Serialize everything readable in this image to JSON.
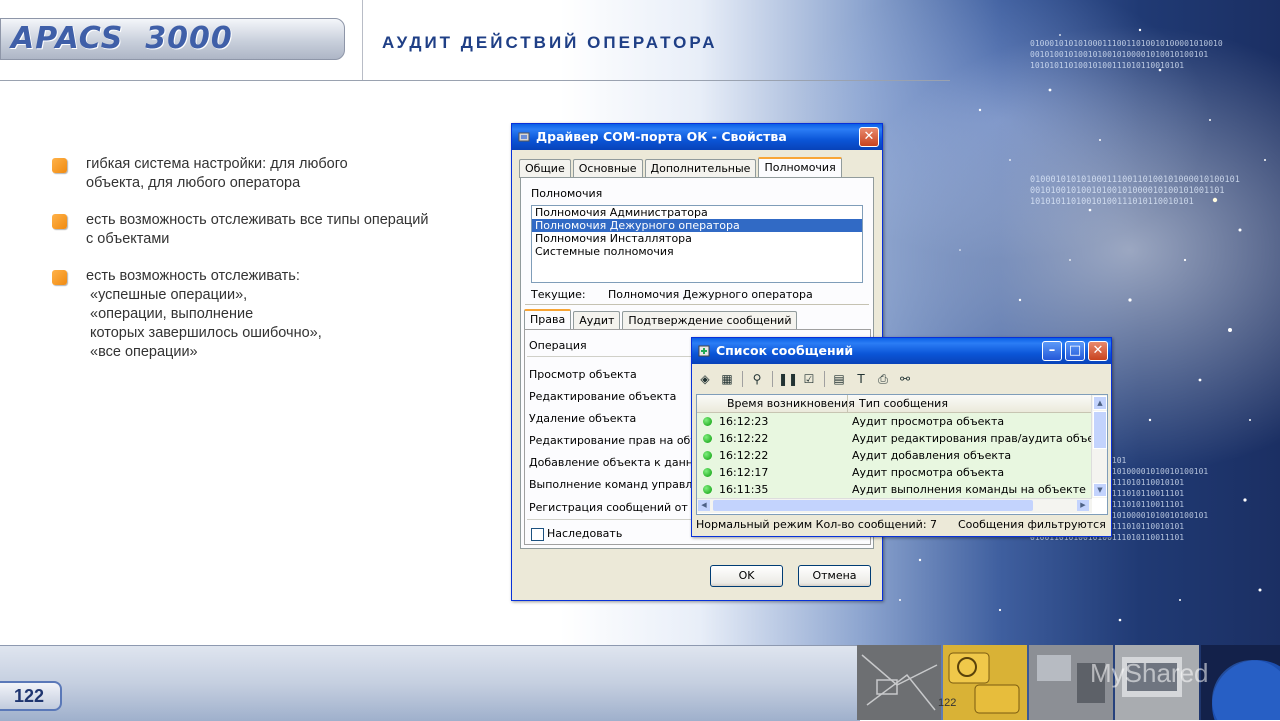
{
  "logo": {
    "brand": "APACS",
    "number": "3000"
  },
  "page_title": "АУДИТ ДЕЙСТВИЙ ОПЕРАТОРА",
  "bullets": [
    {
      "lines": [
        "гибкая система настройки: для любого",
        "объекта, для любого оператора"
      ]
    },
    {
      "lines": [
        "есть возможность отслеживать все типы операций",
        "с объектами"
      ]
    },
    {
      "lines": [
        "есть возможность отслеживать:",
        "«успешные операции»,",
        "«операции, выполнение",
        "которых завершилось ошибочно»,",
        "«все операции»"
      ]
    }
  ],
  "props_window": {
    "title": "Драйвер COM-порта ОК - Свойства",
    "tabs": [
      "Общие",
      "Основные",
      "Дополнительные",
      "Полномочия"
    ],
    "active_tab": "Полномочия",
    "group_label": "Полномочия",
    "list_items": [
      "Полномочия Администратора",
      "Полномочия Дежурного оператора",
      "Полномочия Инсталлятора",
      "Системные полномочия"
    ],
    "selected_item": "Полномочия Дежурного оператора",
    "current_label": "Текущие:",
    "current_value": "Полномочия Дежурного оператора",
    "sub_tabs": [
      "Права",
      "Аудит",
      "Подтверждение сообщений"
    ],
    "operation_header": "Операция",
    "operations": [
      "Просмотр объекта",
      "Редактирование объекта",
      "Удаление объекта",
      "Редактирование прав на объект",
      "Добавление объекта к данному",
      "Выполнение команд управления",
      "Регистрация сообщений от объе"
    ],
    "inherit_label": "Наследовать",
    "ok_label": "OK",
    "cancel_label": "Отмена"
  },
  "msg_window": {
    "title": "Список сообщений",
    "columns": [
      "Время возникновения",
      "Тип сообщения"
    ],
    "rows": [
      {
        "time": "16:12:23",
        "type": "Аудит просмотра объекта"
      },
      {
        "time": "16:12:22",
        "type": "Аудит редактирования прав/аудита объекта"
      },
      {
        "time": "16:12:22",
        "type": "Аудит добавления объекта"
      },
      {
        "time": "16:12:17",
        "type": "Аудит просмотра объекта"
      },
      {
        "time": "16:11:35",
        "type": "Аудит выполнения команды на объекте"
      }
    ],
    "status_left": "Нормальный режим Кол-во сообщений: 7",
    "status_right": "Сообщения фильтруются"
  },
  "footer": {
    "page_number": "122",
    "small_number": "122",
    "watermark": "MyShared"
  },
  "binary_blocks": [
    "0100010101010001110011010010100001010010\n0010100101001010010100001010010100101\n10101011010010100111010110010101",
    "01000101010100011100110100101000010100101\n00101001010010100101000010100101001101\n10101011010010100111010110010101",
    "11101011101011001101\n0010100101001010010100001010010100101\n10101011010010100111010110010101\n00101010110010100111010110011101\n10101011010010100111010110011101\n0010100101001010010100001010010100101\n10101011010010100111010110010101\n01001101010010100111010110011101"
  ]
}
